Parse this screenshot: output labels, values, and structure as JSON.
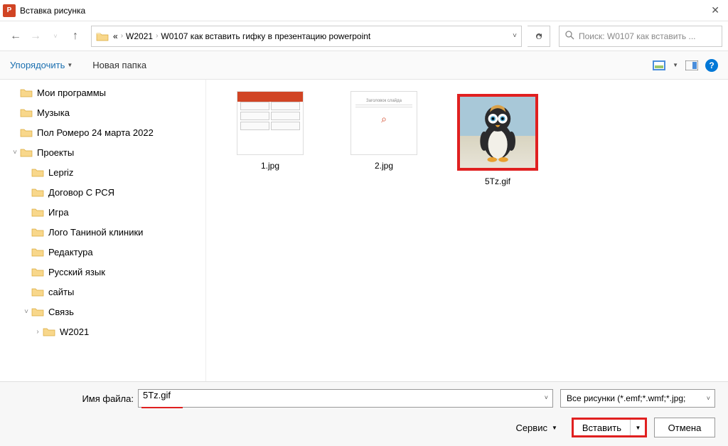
{
  "window": {
    "title": "Вставка рисунка"
  },
  "breadcrumb": {
    "root": "«",
    "seg1": "W2021",
    "seg2": "W0107 как вставить гифку в презентацию powerpoint"
  },
  "search": {
    "placeholder": "Поиск: W0107 как вставить ..."
  },
  "toolbar": {
    "organize": "Упорядочить",
    "newfolder": "Новая папка"
  },
  "tree": {
    "items": [
      "Мои программы",
      "Музыка",
      "Пол Ромеро 24 марта 2022",
      "Проекты",
      "Lepriz",
      "Договор С РСЯ",
      "Игра",
      "Лого Таниной клиники",
      "Редактура",
      "Русский язык",
      "сайты",
      "Связь",
      "W2021"
    ]
  },
  "files": {
    "f1": "1.jpg",
    "f2": "2.jpg",
    "f3": "5Tz.gif"
  },
  "footer": {
    "fname_label": "Имя файла:",
    "fname_value": "5Tz.gif",
    "filter": "Все рисунки (*.emf;*.wmf;*.jpg;",
    "service": "Сервис",
    "insert": "Вставить",
    "cancel": "Отмена"
  }
}
